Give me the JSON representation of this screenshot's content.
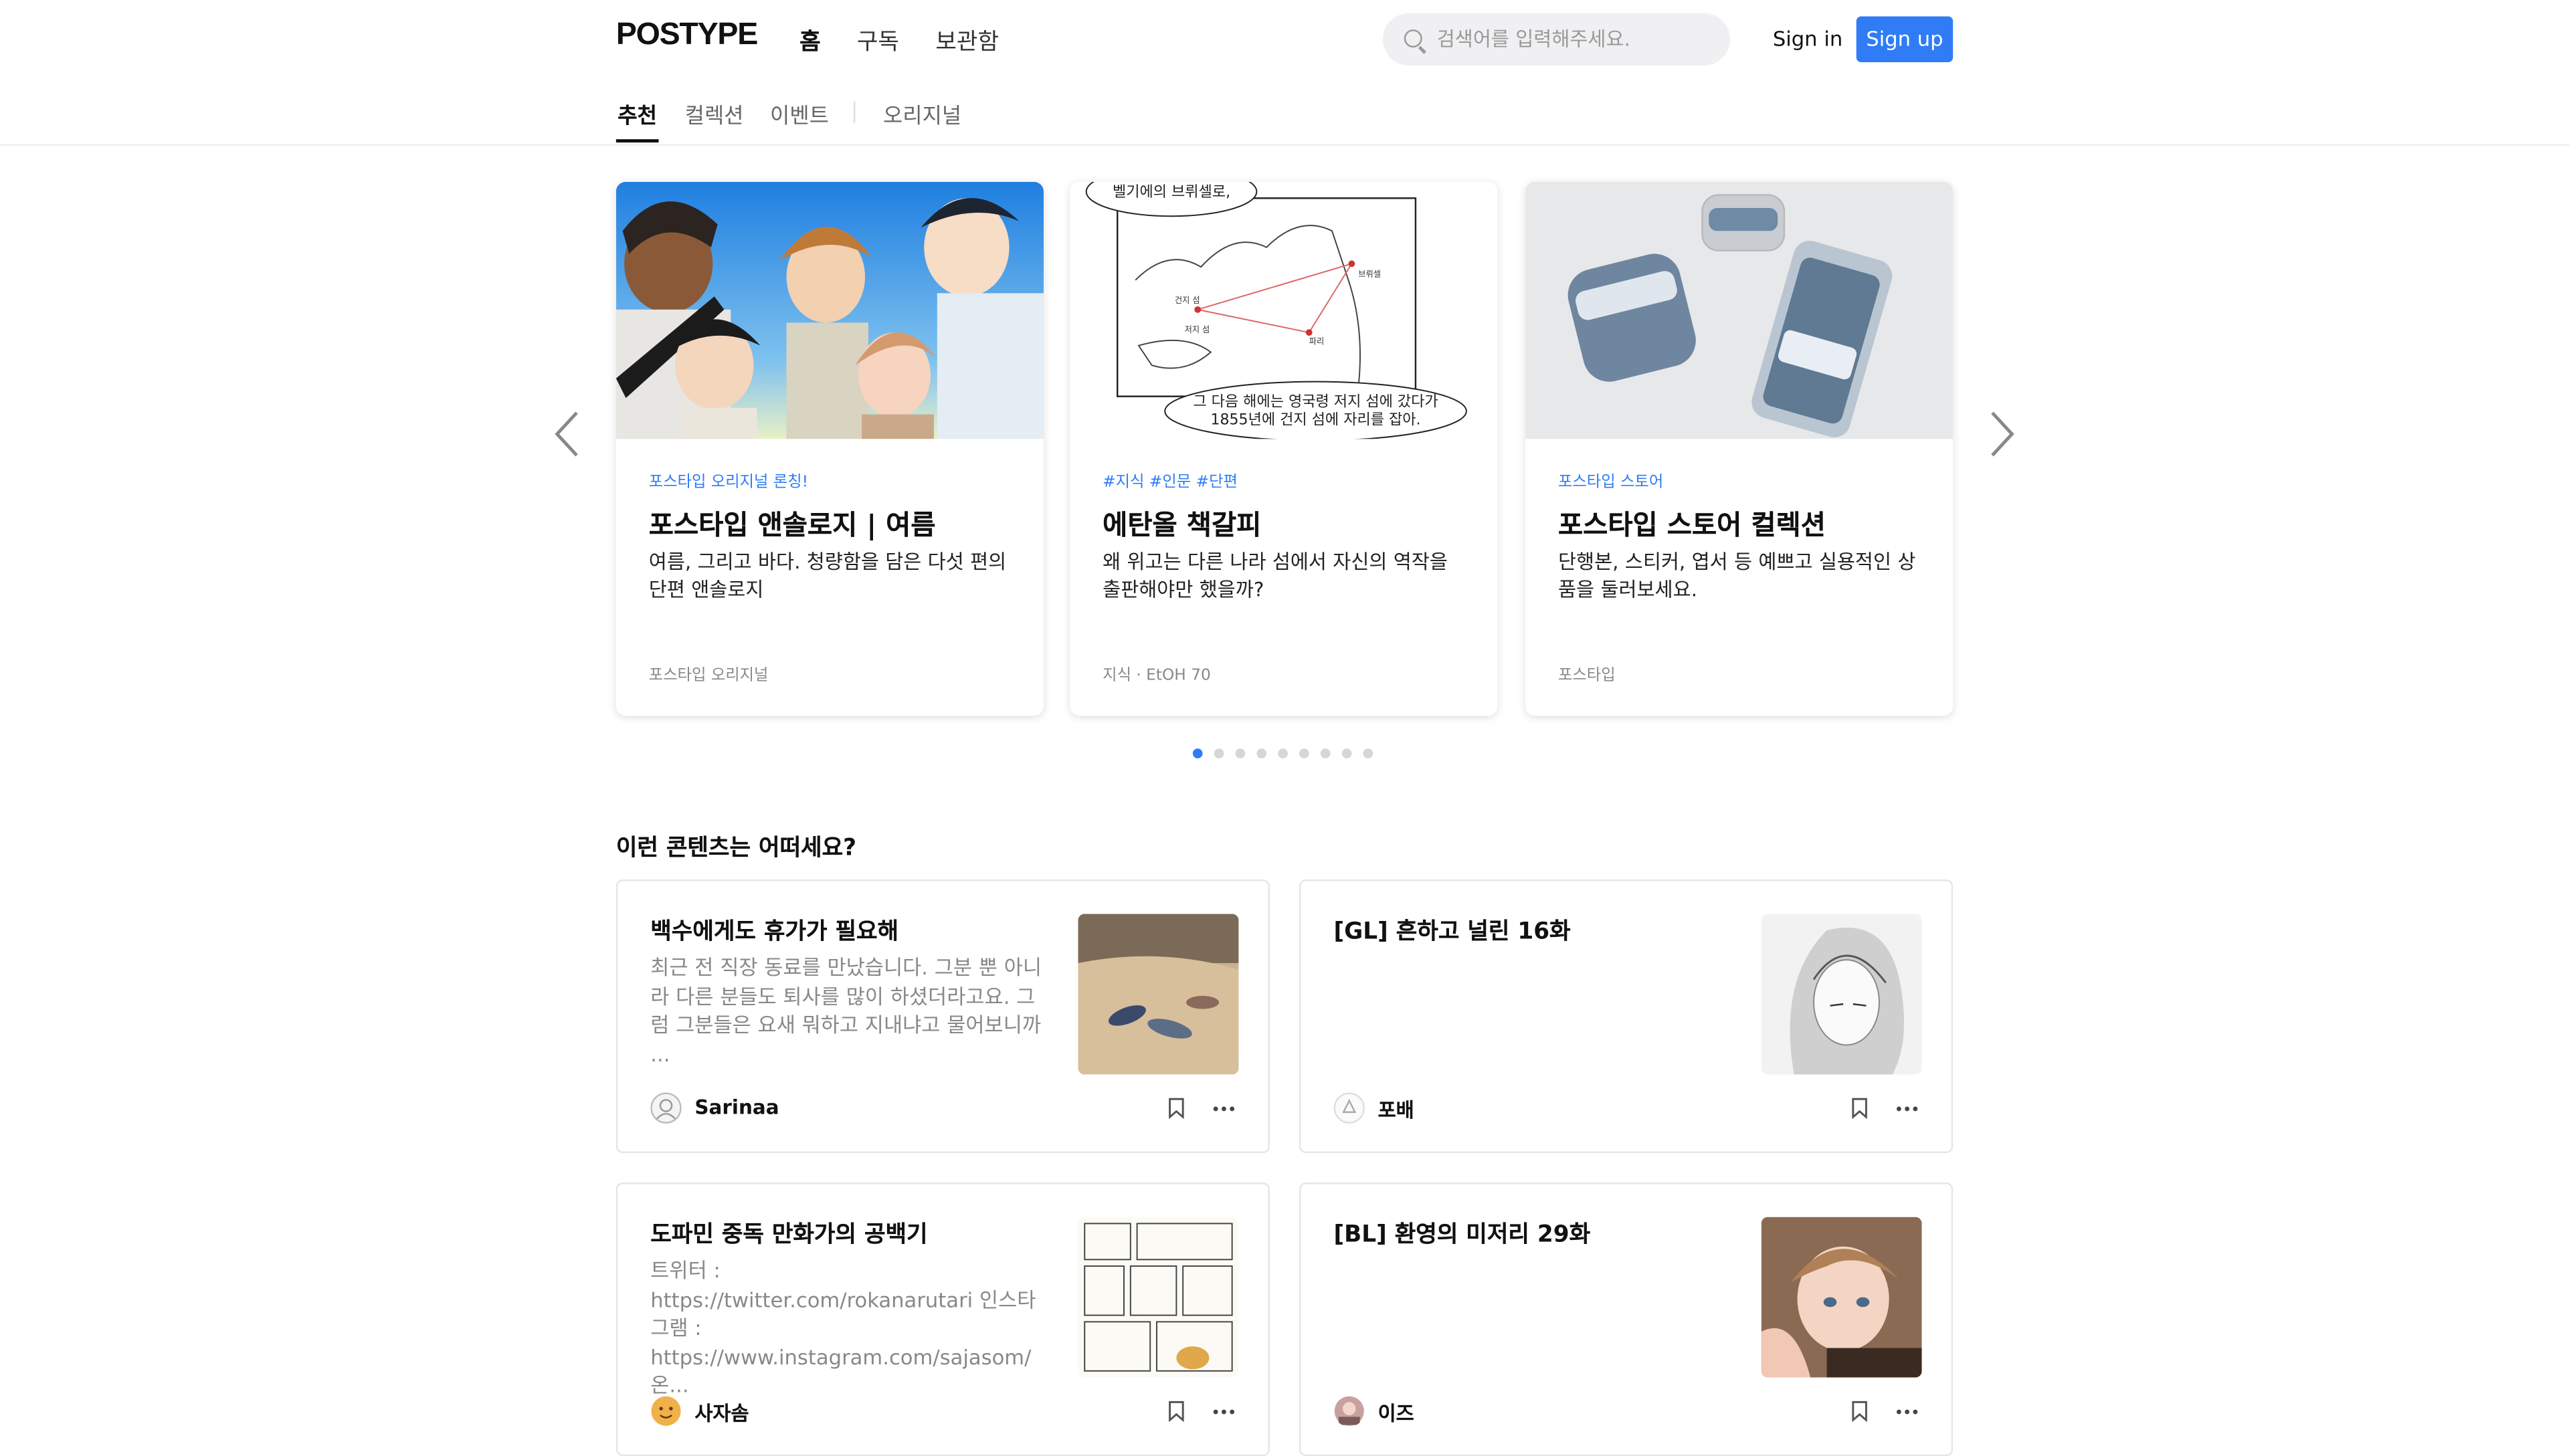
{
  "header": {
    "logo": "POSTYPE",
    "nav": [
      "홈",
      "구독",
      "보관함"
    ],
    "search_placeholder": "검색어를 입력해주세요.",
    "signin": "Sign in",
    "signup": "Sign up"
  },
  "subtabs": [
    "추천",
    "컬렉션",
    "이벤트",
    "오리지널"
  ],
  "carousel": {
    "items": [
      {
        "tag": "포스타입 오리지널 론칭!",
        "title": "포스타입 앤솔로지 | 여름",
        "desc": "여름, 그리고 바다. 청량함을 담은 다섯 편의 단편 앤솔로지",
        "meta": "포스타입 오리지널"
      },
      {
        "tag": "#지식 #인문 #단편",
        "title": "에탄올 책갈피",
        "desc": "왜 위고는 다른 나라 섬에서 자신의 역작을 출판해야만 했을까?",
        "meta": "지식 · EtOH 70",
        "map_bubble_top": "벨기에의 브뤼셀로,",
        "map_bubble_bottom": [
          "그 다음 해에는 영국령 저지 섬에 갔다가",
          "1855년에 건지 섬에 자리를 잡아."
        ],
        "map_labels": [
          "브뤼셀",
          "건지 섬",
          "저지 섬",
          "파리"
        ]
      },
      {
        "tag": "포스타입 스토어",
        "title": "포스타입 스토어 컬렉션",
        "desc": "단행본, 스티커, 엽서 등 예쁘고 실용적인 상품을 둘러보세요.",
        "meta": "포스타입"
      }
    ],
    "dot_count": 9,
    "active_dot": 0
  },
  "recommend": {
    "title": "이런 콘텐츠는 어떠세요?",
    "posts": [
      {
        "title": "백수에게도 휴가가 필요해",
        "excerpt": "최근 전 직장 동료를 만났습니다. 그분 뿐 아니라 다른 분들도 퇴사를 많이 하셨더라고요. 그럼 그분들은 요새 뭐하고 지내냐고 물어보니까 ...",
        "author": "Sarinaa"
      },
      {
        "title": "[GL] 흔하고 널린 16화",
        "excerpt": "",
        "author": "포배"
      },
      {
        "title": "도파민 중독 만화가의 공백기",
        "excerpt": "트위터 : https://twitter.com/rokanarutari 인스타그램 : https://www.instagram.com/sajasom/ 온...",
        "author": "사자솜"
      },
      {
        "title": "[BL] 환영의 미저리 29화",
        "excerpt": "",
        "author": "이즈"
      }
    ]
  },
  "colors": {
    "accent": "#2f7cf6",
    "tag_blue": "#2f7cf6",
    "text": "#111111",
    "muted": "#888888"
  },
  "icons": [
    "search-icon",
    "chevron-left-icon",
    "chevron-right-icon",
    "bookmark-icon",
    "more-icon"
  ]
}
